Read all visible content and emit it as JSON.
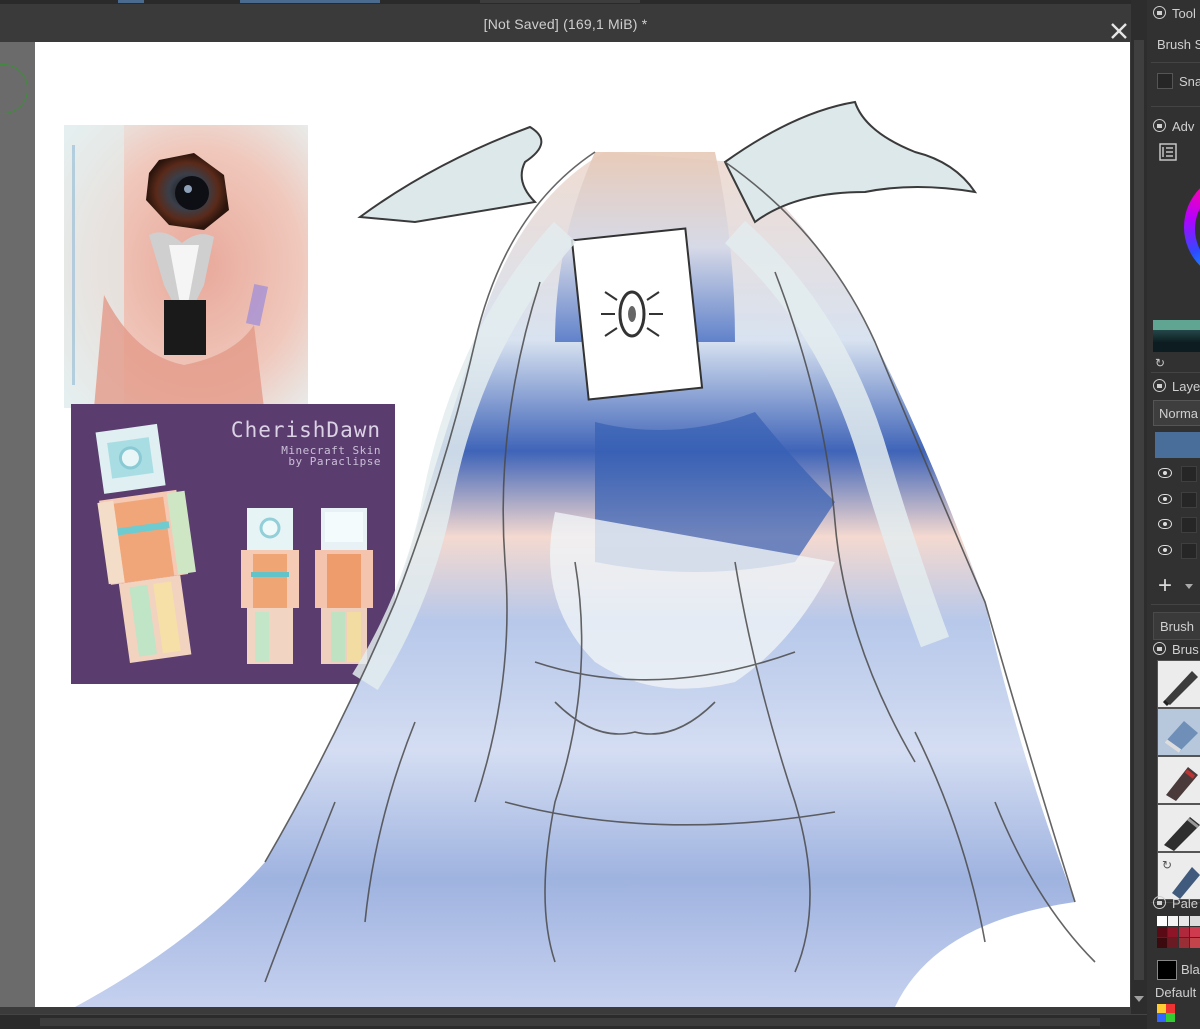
{
  "document": {
    "title": "[Not Saved]  (169,1 MiB) *",
    "close_icon": "close-icon"
  },
  "canvas": {
    "skin_card": {
      "title": "CherishDawn",
      "subtitle_line1": "Minecraft Skin",
      "subtitle_line2": "by Paraclipse"
    }
  },
  "docker": {
    "tool_options_header": "Tool",
    "brush_size_label": "Brush S",
    "snap_label": "Sna",
    "advanced_color_header": "Adv",
    "layers_header": "Laye",
    "blend_mode": "Norma",
    "add_layer_symbol": "+",
    "brush_tab_label": "Brush",
    "brush_presets_header": "Brus",
    "palette_header": "Pale",
    "foreground_color_label": "Blac",
    "palette_name": "Default"
  },
  "colors": {
    "canvas_background": "#ffffff",
    "active_layer": "#4a6e9a",
    "skin_card_background": "#5a3d6e"
  }
}
